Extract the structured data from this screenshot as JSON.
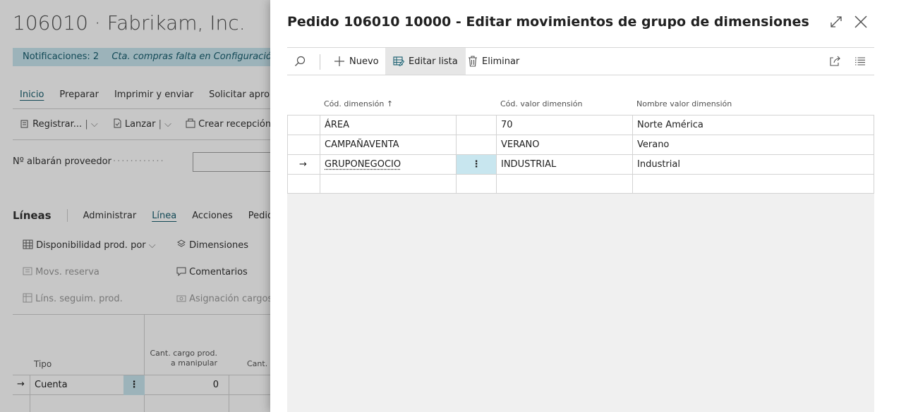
{
  "background_page": {
    "title": "106010 · Fabrikam, Inc.",
    "notifications_label": "Notificaciones: 2",
    "notification_message": "Cta. compras falta en Configuración d",
    "action_tabs": [
      "Inicio",
      "Preparar",
      "Imprimir y enviar",
      "Solicitar aproba"
    ],
    "toolbar": {
      "register": "Registrar...",
      "release": "Lanzar",
      "create_receipt": "Crear recepción"
    },
    "vendor_shipment_label": "Nº albarán proveedor",
    "lines": {
      "heading": "Líneas",
      "tabs": [
        "Administrar",
        "Línea",
        "Acciones",
        "Pedido"
      ],
      "actions": {
        "availability": "Disponibilidad prod. por",
        "dimensions": "Dimensiones",
        "reservations": "Movs. reserva",
        "comments": "Comentarios",
        "tracking": "Líns. seguim. prod.",
        "charge_assign": "Asignación cargos"
      },
      "columns": {
        "type": "Tipo",
        "qty_to_handle_1": "Cant. cargo prod.",
        "qty_to_handle_2": "a manipular",
        "qty_next": "Cant. a"
      },
      "row": {
        "arrow": "→",
        "type": "Cuenta",
        "qty": "0"
      }
    }
  },
  "dialog": {
    "title": "Pedido 106010 10000 - Editar movimientos de grupo de dimensiones",
    "toolbar": {
      "new_label": "Nuevo",
      "edit_list_label": "Editar lista",
      "delete_label": "Eliminar"
    },
    "columns": {
      "dimension_code": "Cód. dimensión ↑",
      "dimension_value_code": "Cód. valor dimensión",
      "dimension_value_name": "Nombre valor dimensión"
    },
    "rows": [
      {
        "indicator": "",
        "dimension_code": "ÁREA",
        "dimension_value_code": "70",
        "dimension_value_name": "Norte América"
      },
      {
        "indicator": "",
        "dimension_code": "CAMPAÑAVENTA",
        "dimension_value_code": "VERANO",
        "dimension_value_name": "Verano"
      },
      {
        "indicator": "→",
        "dimension_code": "GRUPONEGOCIO",
        "dimension_value_code": "INDUSTRIAL",
        "dimension_value_name": "Industrial",
        "menu": "⋮"
      }
    ],
    "selected_row": 2
  },
  "colors": {
    "accent_light": "#c8e6ef",
    "accent_text": "#185e6f",
    "active_toolbar": "#e6e6e6"
  }
}
